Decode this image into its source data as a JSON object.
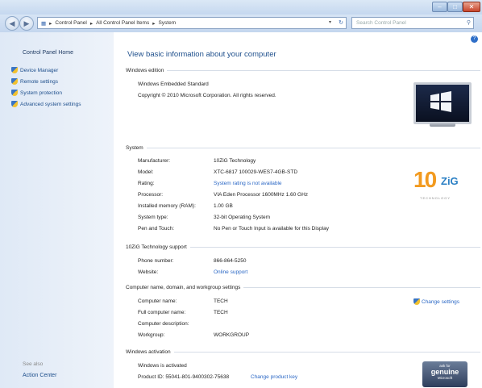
{
  "address": {
    "parts": [
      "Control Panel",
      "All Control Panel Items",
      "System"
    ],
    "search_placeholder": "Search Control Panel"
  },
  "sidebar": {
    "home": "Control Panel Home",
    "items": [
      {
        "label": "Device Manager"
      },
      {
        "label": "Remote settings"
      },
      {
        "label": "System protection"
      },
      {
        "label": "Advanced system settings"
      }
    ],
    "see_also": "See also",
    "action_center": "Action Center"
  },
  "main": {
    "title": "View basic information about your computer",
    "edition_header": "Windows edition",
    "edition": "Windows Embedded Standard",
    "copyright": "Copyright © 2010 Microsoft Corporation. All rights reserved.",
    "system_header": "System",
    "system": [
      {
        "label": "Manufacturer:",
        "value": "10ZiG Technology"
      },
      {
        "label": "Model:",
        "value": "XTC-6817 100029-WES7-4GB-STD"
      },
      {
        "label": "Rating:",
        "value": "System rating is not available",
        "link": true
      },
      {
        "label": "Processor:",
        "value": "VIA Eden Processor 1600MHz  1.60 GHz"
      },
      {
        "label": "Installed memory (RAM):",
        "value": "1.00 GB"
      },
      {
        "label": "System type:",
        "value": "32-bit Operating System"
      },
      {
        "label": "Pen and Touch:",
        "value": "No Pen or Touch Input is available for this Display"
      }
    ],
    "oem_logo": {
      "number": "10",
      "mark": "ZiG",
      "subtitle": "TECHNOLOGY"
    },
    "support_header": "10ZiG Technology support",
    "support": [
      {
        "label": "Phone number:",
        "value": "866-864-5250"
      },
      {
        "label": "Website:",
        "value": "Online support",
        "link": true
      }
    ],
    "computer_header": "Computer name, domain, and workgroup settings",
    "computer": [
      {
        "label": "Computer name:",
        "value": "TECH"
      },
      {
        "label": "Full computer name:",
        "value": "TECH"
      },
      {
        "label": "Computer description:",
        "value": ""
      },
      {
        "label": "Workgroup:",
        "value": "WORKGROUP"
      }
    ],
    "change_settings": "Change settings",
    "activation_header": "Windows activation",
    "activation_status": "Windows is activated",
    "product_id": "Product ID: 55041-801-9400302-75638",
    "change_key": "Change product key",
    "genuine": {
      "line1": "ask for",
      "line2": "genuine",
      "line3": "Microsoft"
    }
  }
}
